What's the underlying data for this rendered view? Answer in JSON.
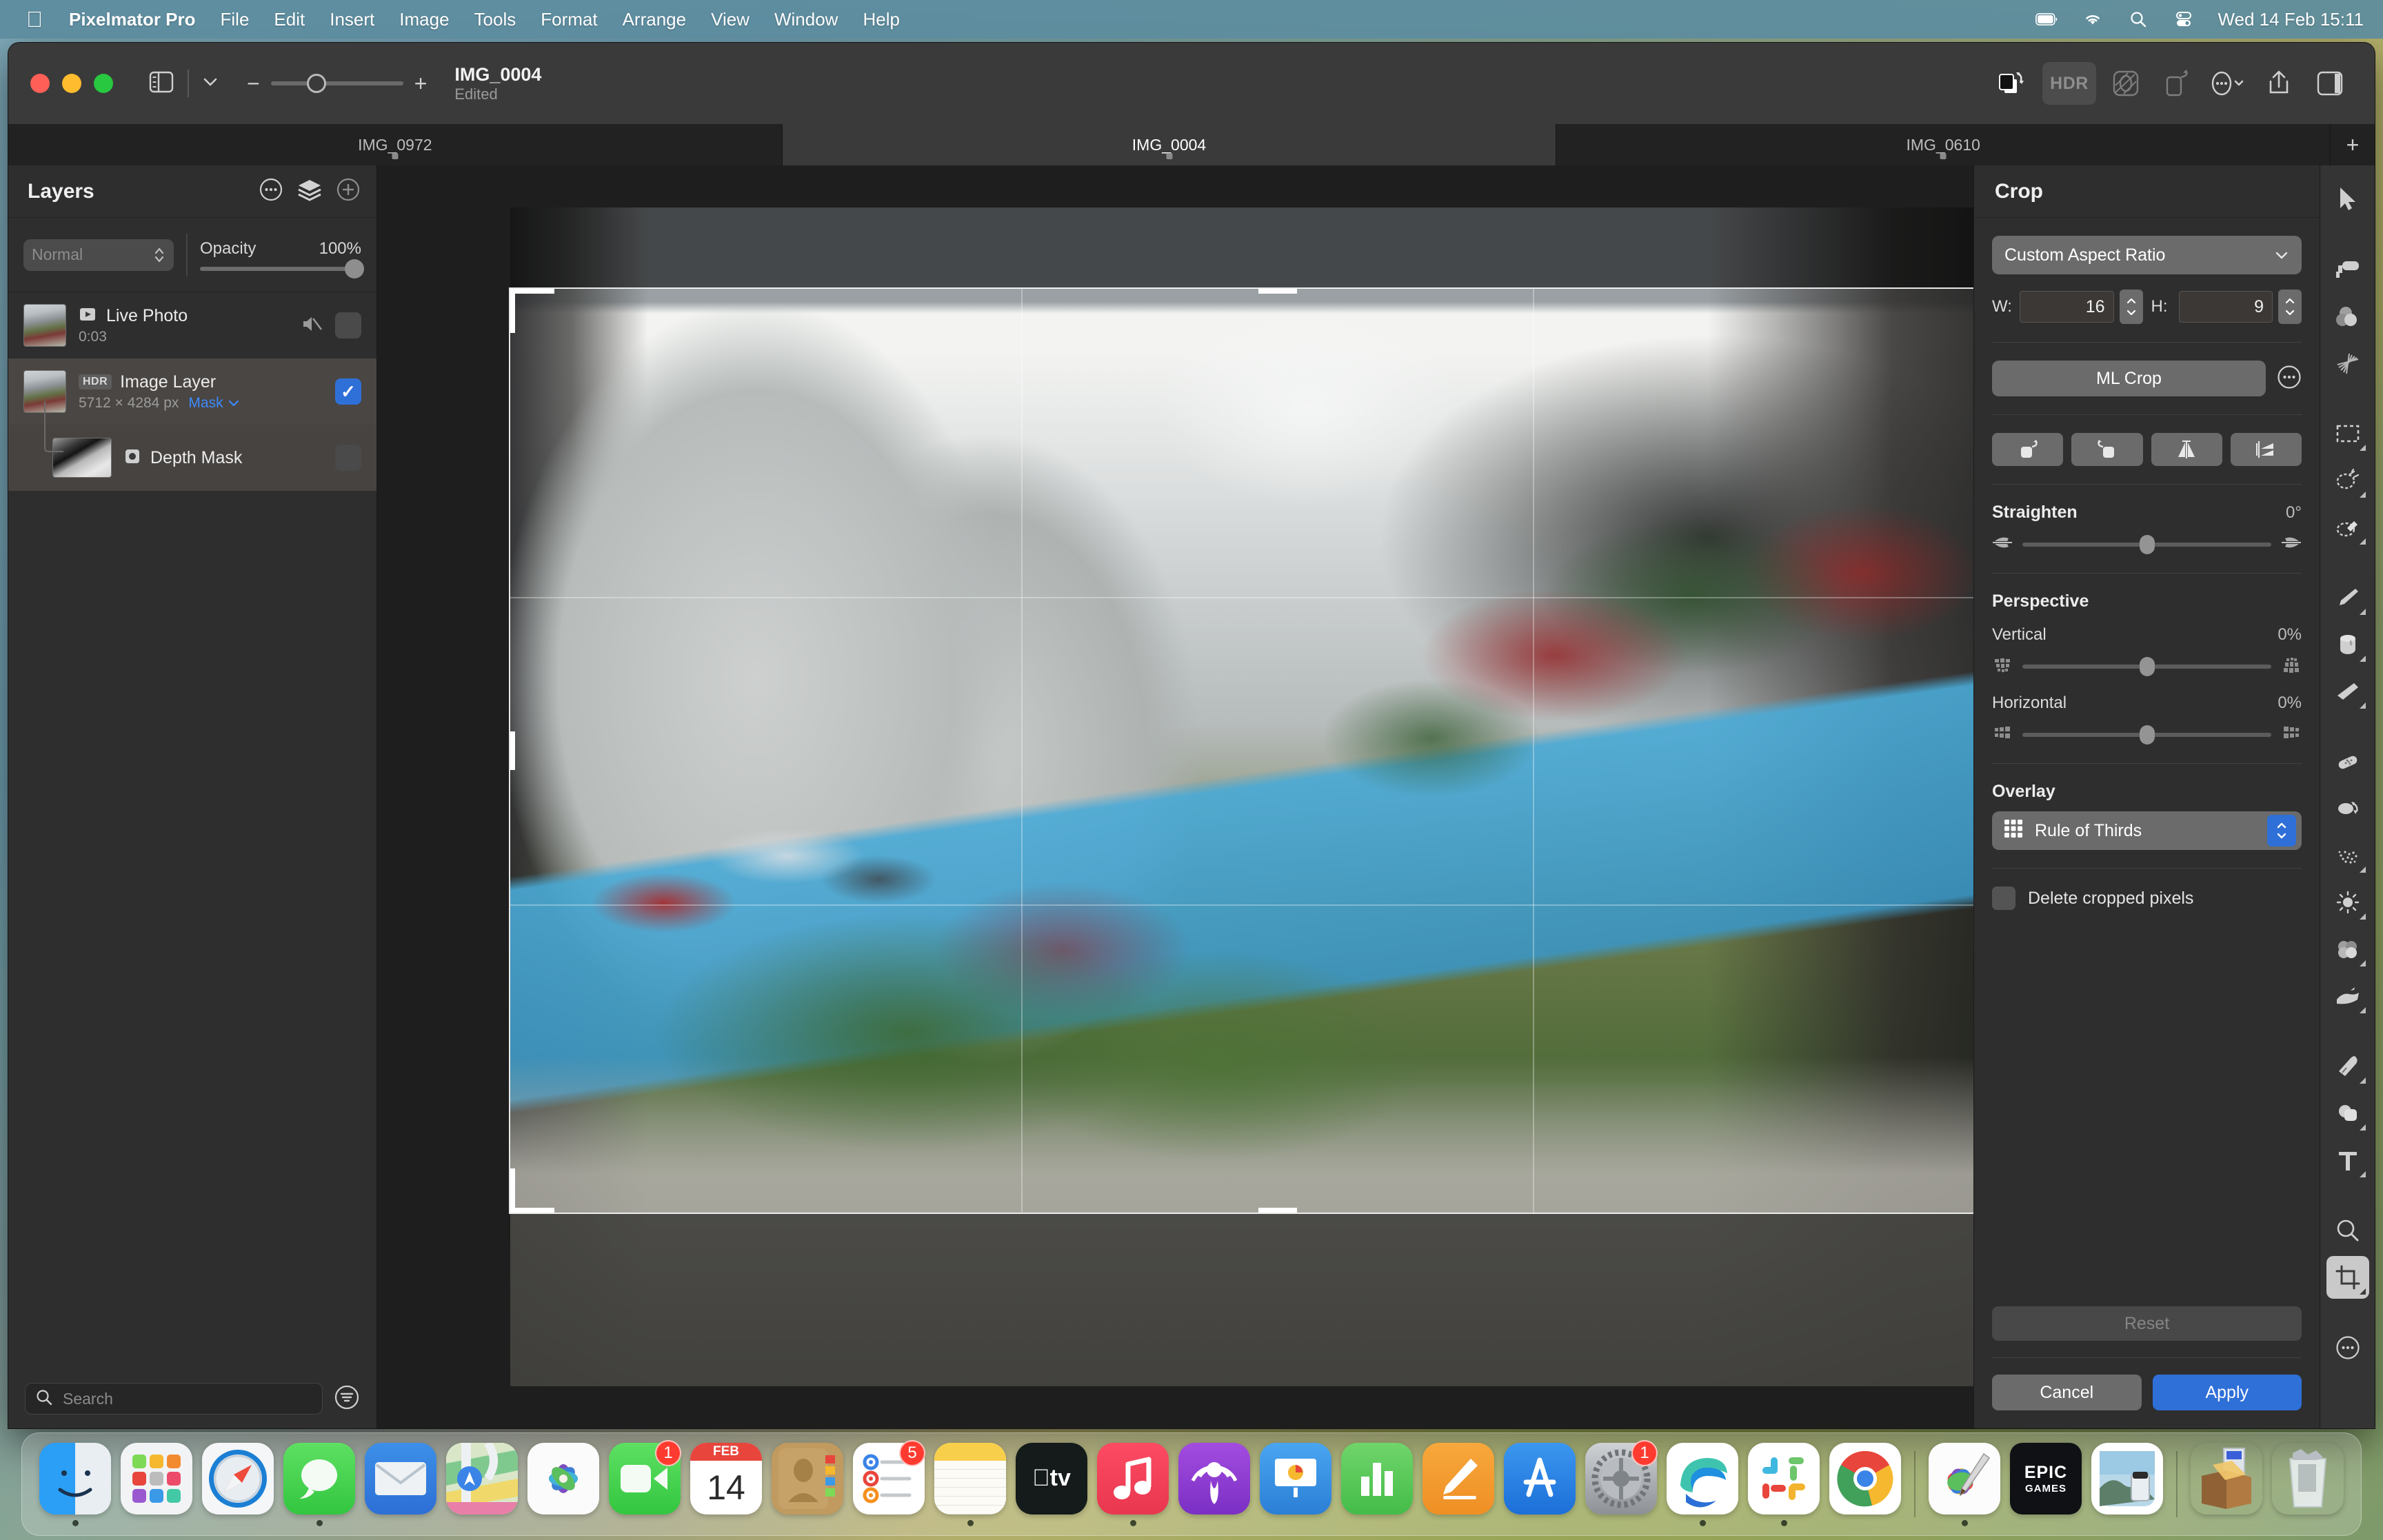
{
  "menubar": {
    "apple_icon": "apple-logo-icon",
    "app_name": "Pixelmator Pro",
    "items": [
      "File",
      "Edit",
      "Insert",
      "Image",
      "Tools",
      "Format",
      "Arrange",
      "View",
      "Window",
      "Help"
    ],
    "status_icons": [
      "battery-icon",
      "wifi-icon",
      "search-icon",
      "control-center-icon"
    ],
    "clock": "Wed 14 Feb  15:11",
    "bar_color": "#5c8c9e"
  },
  "toolbar": {
    "sidebar_toggle": "sidebar-toggle-icon",
    "sidebar_chevron": "chevron-down-icon",
    "zoom_out": "−",
    "zoom_in": "+",
    "document_title": "IMG_0004",
    "document_status": "Edited",
    "right_buttons": [
      {
        "name": "layer-flip-icon",
        "label": ""
      },
      {
        "name": "hdr-button",
        "label": "HDR"
      },
      {
        "name": "color-adjust-icon",
        "label": ""
      },
      {
        "name": "rotate-icon",
        "label": ""
      },
      {
        "name": "more-options-icon",
        "label": ""
      },
      {
        "name": "share-icon",
        "label": ""
      },
      {
        "name": "inspector-toggle-icon",
        "label": ""
      }
    ]
  },
  "tabs": {
    "items": [
      {
        "label": "IMG_0972",
        "active": false
      },
      {
        "label": "IMG_0004",
        "active": true
      },
      {
        "label": "IMG_0610",
        "active": false
      }
    ],
    "add_label": "+"
  },
  "layers_panel": {
    "title": "Layers",
    "header_icons": [
      "more-options-icon",
      "layers-stack-icon",
      "add-layer-icon"
    ],
    "blend_mode": "Normal",
    "opacity_label": "Opacity",
    "opacity_value": "100%",
    "layers": [
      {
        "name": "Live Photo",
        "sub": "0:03",
        "badge": "",
        "type_icon": "live-photo-icon",
        "muted_icon": "speaker-mute-icon",
        "visible": false,
        "selected": false
      },
      {
        "name": "Image Layer",
        "sub": "5712 × 4284 px",
        "badge": "HDR",
        "mask_label": "Mask",
        "type_icon": "hdr-badge-icon",
        "visible": true,
        "selected": true
      },
      {
        "name": "Depth Mask",
        "sub": "",
        "badge": "",
        "type_icon": "mask-icon",
        "visible": false,
        "selected": false
      }
    ],
    "search_placeholder": "Search",
    "filter_icon": "filter-icon"
  },
  "crop_panel": {
    "title": "Crop",
    "aspect_ratio": "Custom Aspect Ratio",
    "width_label": "W:",
    "width_value": "16",
    "height_label": "H:",
    "height_value": "9",
    "ml_crop_label": "ML Crop",
    "ml_crop_options_icon": "more-options-icon",
    "rotate_buttons": [
      "rotate-left-icon",
      "rotate-right-icon",
      "flip-horizontal-icon",
      "flip-vertical-icon"
    ],
    "straighten_label": "Straighten",
    "straighten_value": "0°",
    "perspective_label": "Perspective",
    "vertical_label": "Vertical",
    "vertical_value": "0%",
    "horizontal_label": "Horizontal",
    "horizontal_value": "0%",
    "overlay_label": "Overlay",
    "overlay_value": "Rule of Thirds",
    "delete_cropped_label": "Delete cropped pixels",
    "delete_cropped_checked": false,
    "reset_label": "Reset",
    "cancel_label": "Cancel",
    "apply_label": "Apply",
    "accent_color": "#2f6fd8"
  },
  "tools": [
    {
      "name": "arrow-select-tool",
      "glyph": "arrow",
      "active": false,
      "submenu": false
    },
    {
      "name": "paint-roller-tool",
      "glyph": "roller",
      "active": false,
      "submenu": false
    },
    {
      "name": "color-adjustments-tool",
      "glyph": "circles",
      "active": false,
      "submenu": false
    },
    {
      "name": "effects-tool",
      "glyph": "effects",
      "active": false,
      "submenu": false
    },
    {
      "name": "rectangular-marquee-tool",
      "glyph": "marquee",
      "active": false,
      "submenu": true
    },
    {
      "name": "quick-selection-tool",
      "glyph": "quickselect",
      "active": false,
      "submenu": true
    },
    {
      "name": "magic-wand-tool",
      "glyph": "wand",
      "active": false,
      "submenu": true
    },
    {
      "name": "paint-brush-tool",
      "glyph": "brush",
      "active": false,
      "submenu": true
    },
    {
      "name": "paint-bucket-tool",
      "glyph": "bucket",
      "active": false,
      "submenu": true
    },
    {
      "name": "eraser-tool",
      "glyph": "eraser",
      "active": false,
      "submenu": true
    },
    {
      "name": "repair-tool",
      "glyph": "bandage",
      "active": false,
      "submenu": false
    },
    {
      "name": "clone-stamp-tool",
      "glyph": "clone",
      "active": false,
      "submenu": false
    },
    {
      "name": "smudge-tool",
      "glyph": "smudge",
      "active": false,
      "submenu": true
    },
    {
      "name": "lighten-tool",
      "glyph": "sun",
      "active": false,
      "submenu": true
    },
    {
      "name": "saturation-tool",
      "glyph": "saturation",
      "active": false,
      "submenu": true
    },
    {
      "name": "warp-tool",
      "glyph": "warp",
      "active": false,
      "submenu": true
    },
    {
      "name": "pen-tool",
      "glyph": "pen",
      "active": false,
      "submenu": true
    },
    {
      "name": "shapes-tool",
      "glyph": "shapes",
      "active": false,
      "submenu": true
    },
    {
      "name": "type-tool",
      "glyph": "type",
      "active": false,
      "submenu": true
    },
    {
      "name": "zoom-tool",
      "glyph": "magnifier",
      "active": false,
      "submenu": false
    },
    {
      "name": "crop-tool",
      "glyph": "crop",
      "active": true,
      "submenu": true
    },
    {
      "name": "more-tools",
      "glyph": "ellipsis",
      "active": false,
      "submenu": false
    }
  ],
  "dock": [
    {
      "name": "finder",
      "running": true
    },
    {
      "name": "launchpad",
      "running": false
    },
    {
      "name": "safari",
      "running": false
    },
    {
      "name": "messages",
      "running": true
    },
    {
      "name": "mail",
      "running": false
    },
    {
      "name": "maps",
      "running": false
    },
    {
      "name": "photos",
      "running": false
    },
    {
      "name": "facetime",
      "running": false,
      "badge": "1"
    },
    {
      "name": "calendar",
      "running": false,
      "date_month": "FEB",
      "date_day": "14"
    },
    {
      "name": "contacts",
      "running": false
    },
    {
      "name": "reminders",
      "running": false,
      "badge": "5"
    },
    {
      "name": "notes",
      "running": true
    },
    {
      "name": "appletv",
      "running": false
    },
    {
      "name": "music",
      "running": true
    },
    {
      "name": "podcasts",
      "running": false
    },
    {
      "name": "keynote",
      "running": false
    },
    {
      "name": "numbers",
      "running": false
    },
    {
      "name": "pages",
      "running": false
    },
    {
      "name": "appstore",
      "running": false
    },
    {
      "name": "system-settings",
      "running": false,
      "badge": "1"
    },
    {
      "name": "edge",
      "running": true
    },
    {
      "name": "slack",
      "running": true
    },
    {
      "name": "chrome",
      "running": false
    },
    {
      "name": "separator"
    },
    {
      "name": "pixelmator-pro",
      "running": true
    },
    {
      "name": "epic-games",
      "running": false
    },
    {
      "name": "preview",
      "running": false
    },
    {
      "name": "separator2"
    },
    {
      "name": "downloads-stack",
      "running": false
    },
    {
      "name": "trash",
      "running": false
    }
  ],
  "canvas": {
    "overlay_mode": "Rule of Thirds",
    "image_description": "Street view with flower-decorated pub facade"
  }
}
